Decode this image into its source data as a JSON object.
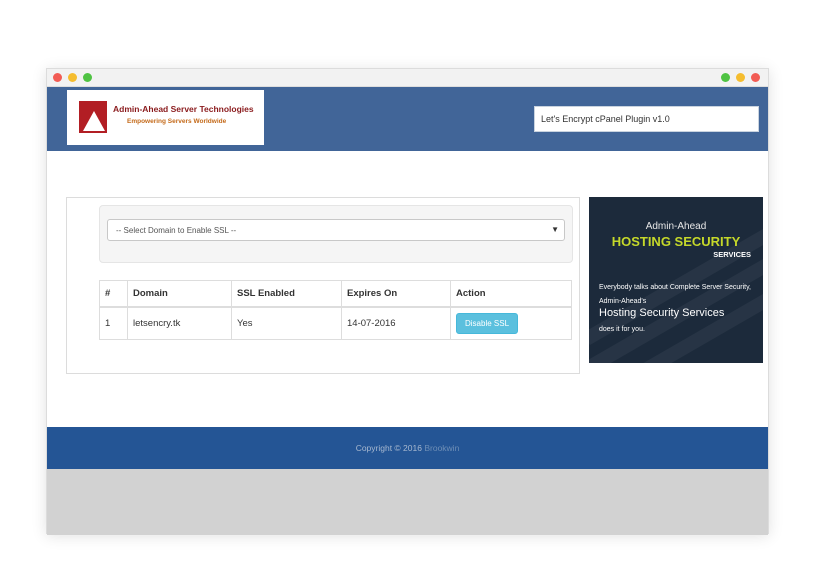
{
  "window": {
    "controls_left": [
      "close",
      "minimize",
      "maximize"
    ],
    "controls_right": [
      "maximize",
      "minimize",
      "close"
    ]
  },
  "header": {
    "logo_title": "Admin-Ahead Server Technologies",
    "logo_tagline": "Empowering Servers Worldwide",
    "plugin_label": "Let's Encrypt cPanel Plugin v1.0"
  },
  "domain_select": {
    "selected": "-- Select Domain to Enable SSL --"
  },
  "table": {
    "headers": [
      "#",
      "Domain",
      "SSL Enabled",
      "Expires On",
      "Action"
    ],
    "rows": [
      {
        "num": "1",
        "domain": "letsencry.tk",
        "ssl": "Yes",
        "expires": "14-07-2016",
        "action": "Disable SSL"
      }
    ]
  },
  "ad": {
    "line1": "Admin-Ahead",
    "line2": "HOSTING SECURITY",
    "line3": "SERVICES",
    "body": "Everybody talks about Complete Server Security, Admin-Ahead's",
    "highlight": "Hosting Security Services",
    "tail": "does it for you."
  },
  "footer": {
    "copyright": "Copyright © 2016",
    "brand": "Brookwin"
  },
  "colors": {
    "header": "#416598",
    "footer": "#245595",
    "button": "#5bc0de",
    "ad_accent": "#c5d82a"
  }
}
